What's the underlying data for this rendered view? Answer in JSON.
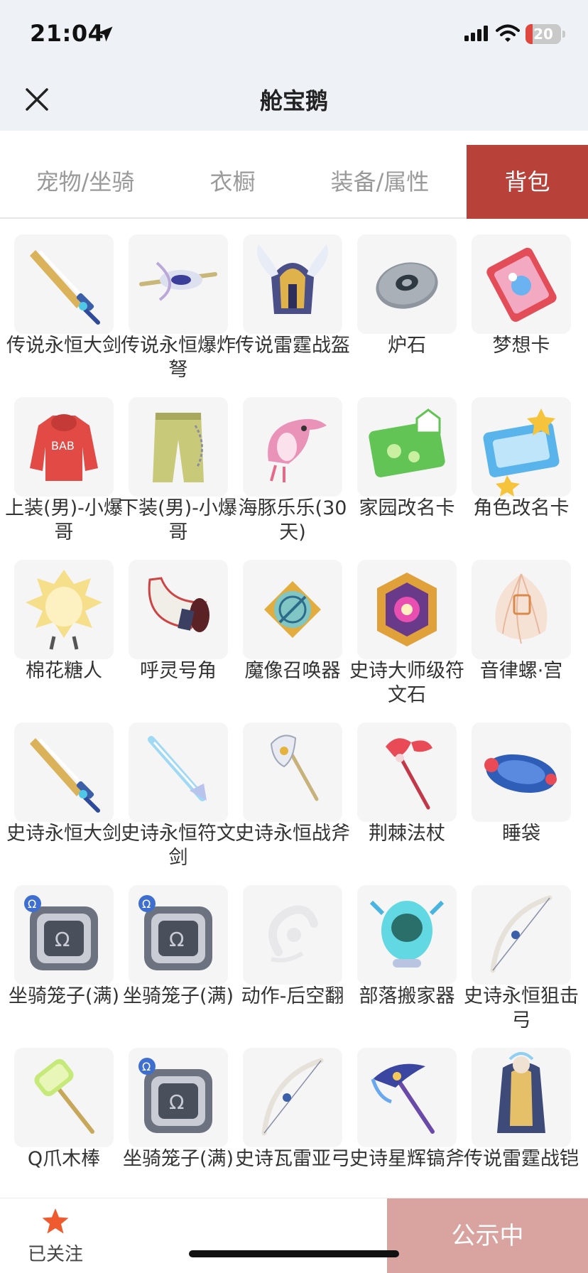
{
  "status_bar": {
    "time": "21:04",
    "battery_level": "20",
    "battery_fraction": 0.2
  },
  "nav": {
    "title": "舱宝鹅",
    "close_icon": "close-icon"
  },
  "tabs": [
    {
      "label": "宠物/坐骑",
      "active": false
    },
    {
      "label": "衣橱",
      "active": false
    },
    {
      "label": "装备/属性",
      "active": false
    },
    {
      "label": "背包",
      "active": true
    }
  ],
  "items": [
    {
      "label": "传说永恒大剑",
      "icon": "sword-icon"
    },
    {
      "label": "传说永恒爆炸弩",
      "icon": "crossbow-icon"
    },
    {
      "label": "传说雷霆战盔",
      "icon": "helmet-icon"
    },
    {
      "label": "炉石",
      "icon": "hearthstone-icon"
    },
    {
      "label": "梦想卡",
      "icon": "card-icon"
    },
    {
      "label": "上装(男)-小爆哥",
      "icon": "hoodie-icon"
    },
    {
      "label": "下装(男)-小爆哥",
      "icon": "pants-icon"
    },
    {
      "label": "海豚乐乐(30天)",
      "icon": "dolphin-icon"
    },
    {
      "label": "家园改名卡",
      "icon": "rename-card-icon"
    },
    {
      "label": "角色改名卡",
      "icon": "role-card-icon"
    },
    {
      "label": "棉花糖人",
      "icon": "marshmallow-icon"
    },
    {
      "label": "呼灵号角",
      "icon": "horn-icon"
    },
    {
      "label": "魔像召唤器",
      "icon": "summoner-icon"
    },
    {
      "label": "史诗大师级符文石",
      "icon": "runestone-icon"
    },
    {
      "label": "音律螺·宫",
      "icon": "shell-icon"
    },
    {
      "label": "史诗永恒大剑",
      "icon": "sword-icon"
    },
    {
      "label": "史诗永恒符文剑",
      "icon": "rune-sword-icon"
    },
    {
      "label": "史诗永恒战斧",
      "icon": "axe-icon"
    },
    {
      "label": "荆棘法杖",
      "icon": "staff-icon"
    },
    {
      "label": "睡袋",
      "icon": "sleeping-bag-icon"
    },
    {
      "label": "坐骑笼子(满)",
      "icon": "cage-icon"
    },
    {
      "label": "坐骑笼子(满)",
      "icon": "cage-icon"
    },
    {
      "label": "动作-后空翻",
      "icon": "backflip-icon"
    },
    {
      "label": "部落搬家器",
      "icon": "relocator-icon"
    },
    {
      "label": "史诗永恒狙击弓",
      "icon": "bow-icon"
    },
    {
      "label": "Q爪木棒",
      "icon": "hammer-icon"
    },
    {
      "label": "坐骑笼子(满)",
      "icon": "cage-icon"
    },
    {
      "label": "史诗瓦雷亚弓",
      "icon": "bow-icon"
    },
    {
      "label": "史诗星辉镐斧",
      "icon": "pickaxe-icon"
    },
    {
      "label": "传说雷霆战铠",
      "icon": "armor-icon"
    }
  ],
  "bottom": {
    "follow_label": "已关注",
    "public_label": "公示中"
  },
  "colors": {
    "accent": "#b8423a",
    "public_button": "#d9a3a0",
    "star": "#ef5a2e"
  }
}
